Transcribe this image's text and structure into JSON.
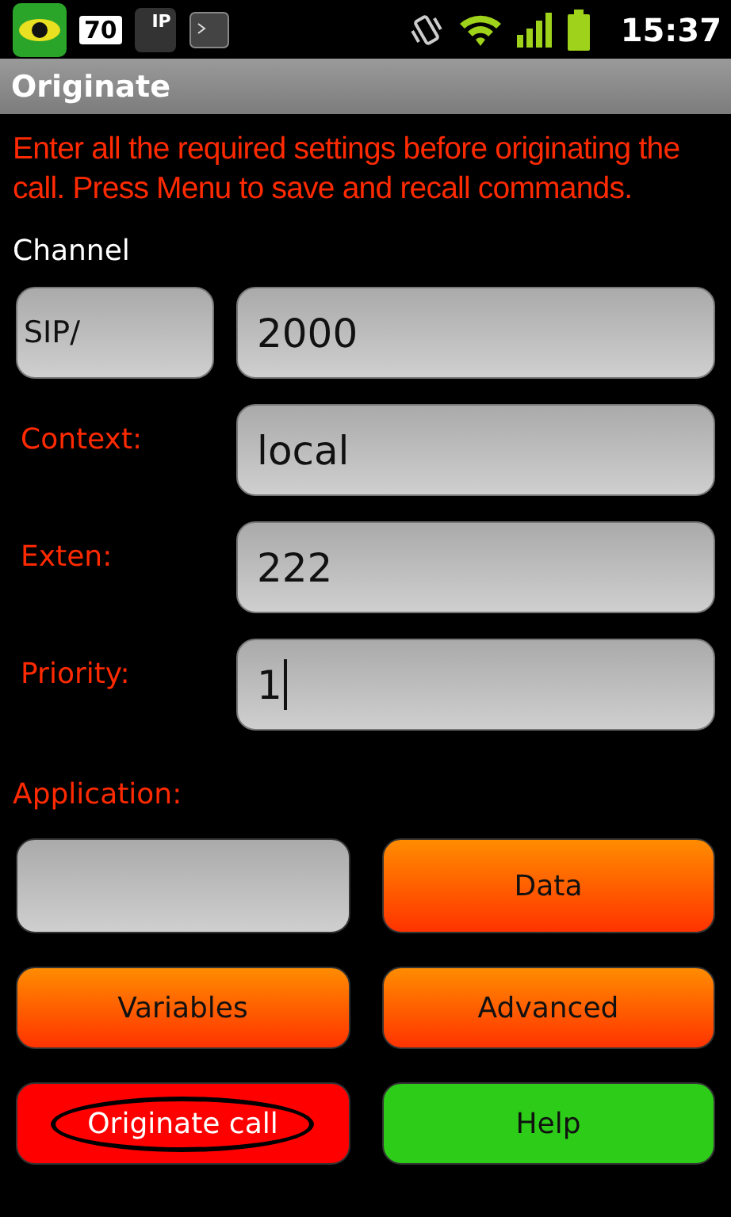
{
  "status_bar": {
    "notifications": [
      {
        "kind": "eye"
      },
      {
        "kind": "count",
        "text": "70"
      },
      {
        "kind": "phone",
        "text": "IP"
      },
      {
        "kind": "terminal"
      }
    ],
    "time": "15:37"
  },
  "title": "Originate",
  "instructions": "Enter all the required settings before originating the call. Press Menu to save and recall commands.",
  "channel": {
    "label": "Channel",
    "prefix": "SIP/",
    "value": "2000"
  },
  "fields": [
    {
      "label": "Context:",
      "value": "local",
      "focused": false
    },
    {
      "label": "Exten:",
      "value": "222",
      "focused": false
    },
    {
      "label": "Priority:",
      "value": "1",
      "focused": true
    }
  ],
  "application": {
    "label": "Application:"
  },
  "buttons": [
    {
      "kind": "plain"
    },
    {
      "kind": "orange",
      "label": "Data",
      "circled": false
    },
    {
      "kind": "orange",
      "label": "Variables",
      "circled": false
    },
    {
      "kind": "orange",
      "label": "Advanced",
      "circled": false
    },
    {
      "kind": "red",
      "label": "Originate call",
      "circled": true
    },
    {
      "kind": "green",
      "label": "Help",
      "circled": false
    }
  ]
}
